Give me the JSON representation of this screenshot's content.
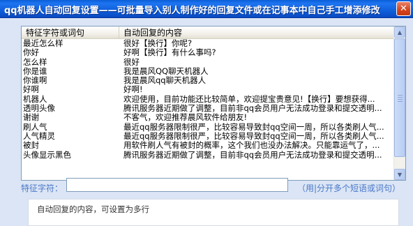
{
  "window": {
    "title": "qq机器人自动回复设置——可批量导入别人制作好的回复文件或在记事本中自己手工增添修改",
    "close_glyph": "✕"
  },
  "list": {
    "columns": [
      "特征字符或词句",
      "自动回复的内容"
    ],
    "rows": [
      {
        "keyword": "最近怎么样",
        "reply": "很好【换行】你呢?"
      },
      {
        "keyword": "你好",
        "reply": "好啊【换行】有什么事吗?"
      },
      {
        "keyword": "怎么样",
        "reply": "很好"
      },
      {
        "keyword": "你是谁",
        "reply": "我是晨风QQ聊天机器人"
      },
      {
        "keyword": "你谁啊",
        "reply": "我是晨风qq聊天机器人"
      },
      {
        "keyword": "好啊",
        "reply": "好啊!"
      },
      {
        "keyword": "机器人",
        "reply": "欢迎使用，目前功能还比较简单，欢迎提宝贵意见!【换行】要想获得..."
      },
      {
        "keyword": "透明头像",
        "reply": "腾讯服务器近期做了调整，目前非qq会员用户无法成功登录和提交透明..."
      },
      {
        "keyword": "谢谢",
        "reply": "不客气，欢迎推荐晨风软件给朋友!"
      },
      {
        "keyword": "刷人气",
        "reply": "最近qq服务器限制很严，比较容易导致封qq空间一周，所以各类刷人气..."
      },
      {
        "keyword": "人气精灵",
        "reply": "最近qq服务器限制很严，比较容易导致封qq空间一周，所以各类刷人气..."
      },
      {
        "keyword": "被封",
        "reply": "用软件刷人气有被封的概率，这个我们也没办法解决。只能靠运气了，..."
      },
      {
        "keyword": "头像显示黑色",
        "reply": "腾讯服务器近期做了调整，目前非qq会员用户无法成功登录和提交透明..."
      }
    ]
  },
  "form": {
    "keyword_label": "特征字符：",
    "keyword_value": "",
    "hint": "（用|分开多个短语或词句）",
    "reply_label": "自动回复的内容，可设置为多行"
  },
  "icons": {
    "scroll_up": "▲",
    "scroll_down": "▼"
  },
  "colors": {
    "titlebar": "#0a5fd8",
    "label_blue": "#4a78c8",
    "close": "#d4431c"
  }
}
